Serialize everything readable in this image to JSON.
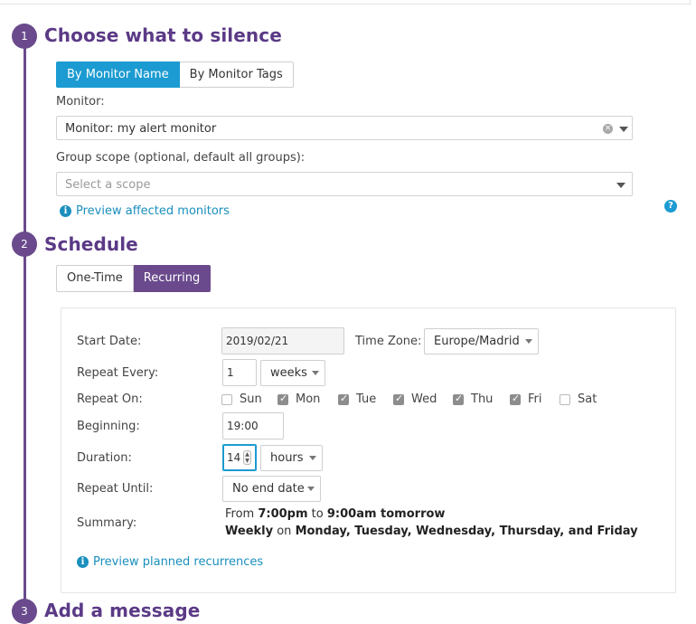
{
  "steps": [
    {
      "number": "1",
      "title": "Choose what to silence"
    },
    {
      "number": "2",
      "title": "Schedule"
    },
    {
      "number": "3",
      "title": "Add a message"
    }
  ],
  "silence": {
    "tabs": [
      {
        "label": "By Monitor Name",
        "active": true
      },
      {
        "label": "By Monitor Tags",
        "active": false
      }
    ],
    "monitor_label": "Monitor:",
    "monitor_value": "Monitor: my alert monitor",
    "group_scope_label": "Group scope (optional, default all groups):",
    "group_scope_placeholder": "Select a scope",
    "preview_link": "Preview affected monitors"
  },
  "schedule": {
    "tabs": [
      {
        "label": "One-Time",
        "active": false
      },
      {
        "label": "Recurring",
        "active": true
      }
    ],
    "start_date_label": "Start Date:",
    "start_date_value": "2019/02/21",
    "timezone_label": "Time Zone:",
    "timezone_value": "Europe/Madrid",
    "repeat_every_label": "Repeat Every:",
    "repeat_every_value": "1",
    "repeat_every_unit": "weeks",
    "repeat_on_label": "Repeat On:",
    "days": [
      {
        "label": "Sun",
        "checked": false
      },
      {
        "label": "Mon",
        "checked": true
      },
      {
        "label": "Tue",
        "checked": true
      },
      {
        "label": "Wed",
        "checked": true
      },
      {
        "label": "Thu",
        "checked": true
      },
      {
        "label": "Fri",
        "checked": true
      },
      {
        "label": "Sat",
        "checked": false
      }
    ],
    "beginning_label": "Beginning:",
    "beginning_value": "19:00",
    "duration_label": "Duration:",
    "duration_value": "14",
    "duration_unit": "hours",
    "repeat_until_label": "Repeat Until:",
    "repeat_until_value": "No end date",
    "summary_label": "Summary:",
    "summary_line1": {
      "from": "From ",
      "start": "7:00pm",
      "to": " to ",
      "end": "9:00am tomorrow"
    },
    "summary_line2": {
      "freq": "Weekly",
      "on": " on ",
      "days": "Monday, Tuesday, Wednesday, Thursday, and Friday"
    },
    "preview_link": "Preview planned recurrences"
  },
  "colors": {
    "accent_purple": "#6a4a8c",
    "title_purple": "#5b3a86",
    "accent_blue": "#1b9bd1",
    "link_blue": "#1a8fbd"
  }
}
